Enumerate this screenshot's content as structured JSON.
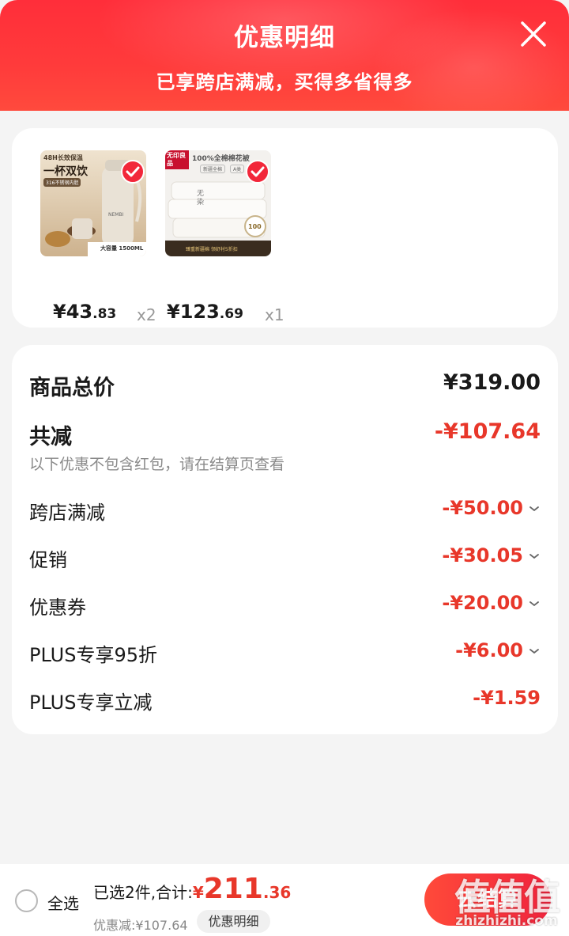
{
  "header": {
    "title": "优惠明细",
    "subtitle": "已享跨店满减，买得多省得多"
  },
  "products": [
    {
      "image_text_top": "48H长效保温",
      "image_text_main": "一杯双饮",
      "image_text_tag": "316不锈钢内胆",
      "image_text_brand": "NEMBI",
      "image_text_bottom": "大容量 1500ML",
      "price_int": "¥43",
      "price_dec": ".83",
      "qty": "x2",
      "checked": true
    },
    {
      "image_text_brand": "无印良品",
      "image_text_top": "100%全棉棉花被",
      "image_text_tag": "新疆全棉",
      "image_text_tag2": "A类",
      "image_text_badge": "100",
      "image_text_side": "无染",
      "image_text_bottom": "臻重新疆棉 领舒衬5折扣",
      "price_int": "¥123",
      "price_dec": ".69",
      "qty": "x1",
      "checked": true
    }
  ],
  "summary": {
    "total_label": "商品总价",
    "total_value": "¥319.00",
    "discount_label": "共减",
    "discount_value": "-¥107.64",
    "note": "以下优惠不包含红包，请在结算页查看",
    "items": [
      {
        "label": "跨店满减",
        "value": "-¥50.00",
        "has_chevron": true
      },
      {
        "label": "促销",
        "value": "-¥30.05",
        "has_chevron": true
      },
      {
        "label": "优惠券",
        "value": "-¥20.00",
        "has_chevron": true
      },
      {
        "label": "PLUS专享95折",
        "value": "-¥6.00",
        "has_chevron": true
      },
      {
        "label": "PLUS专享立减",
        "value": "-¥1.59",
        "has_chevron": false
      }
    ]
  },
  "bottom": {
    "select_all": "全选",
    "selected_text": "已选2件,合计:",
    "total_yen": "¥",
    "total_int": "211",
    "total_dec": ".36",
    "discount_text": "优惠减:¥107.64",
    "detail_button": "优惠明细",
    "checkout_button": "去结算"
  },
  "watermark": {
    "logo": "值值值",
    "url": "zhizhizhi.com"
  },
  "colors": {
    "header_red": "#ff2e3a",
    "accent_red": "#e8372a",
    "check_red": "#f2273a"
  }
}
